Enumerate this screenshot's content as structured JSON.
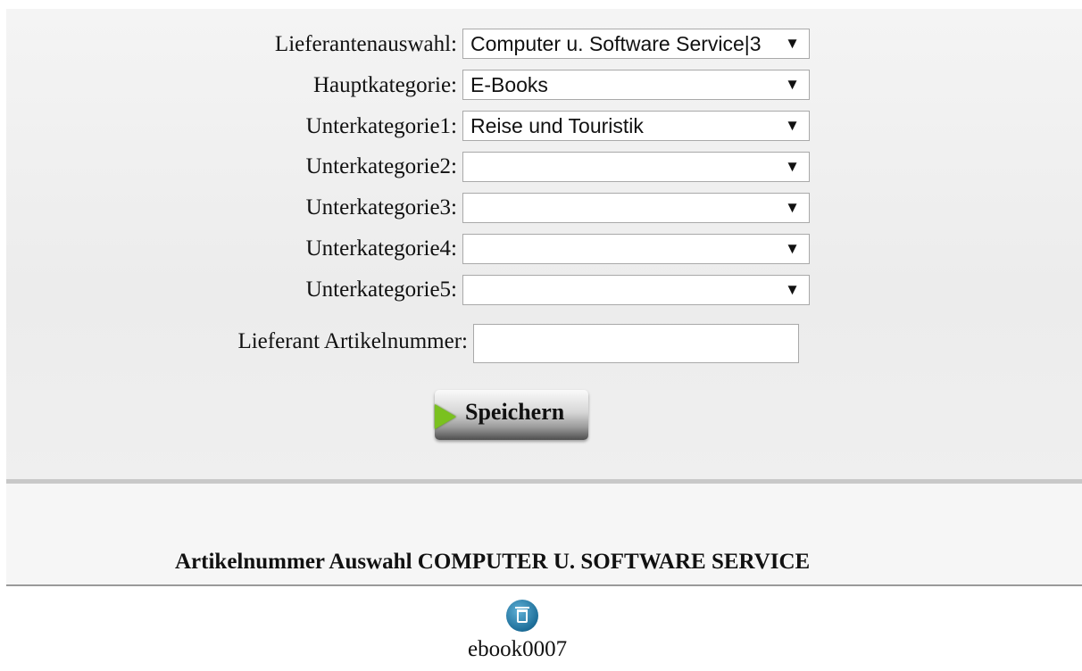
{
  "form": {
    "supplier_label": "Lieferantenauswahl:",
    "supplier_value": "Computer u. Software Service|3",
    "main_category_label": "Hauptkategorie:",
    "main_category_value": "E-Books",
    "sub1_label": "Unterkategorie1:",
    "sub1_value": "Reise und Touristik",
    "sub2_label": "Unterkategorie2:",
    "sub2_value": "",
    "sub3_label": "Unterkategorie3:",
    "sub3_value": "",
    "sub4_label": "Unterkategorie4:",
    "sub4_value": "",
    "sub5_label": "Unterkategorie5:",
    "sub5_value": "",
    "article_number_label": "Lieferant Artikelnummer:",
    "article_number_value": "",
    "save_label": "Speichern",
    "dropdown_arrow": "▼"
  },
  "selection": {
    "heading": "Artikelnummer Auswahl COMPUTER U. SOFTWARE SERVICE",
    "items": [
      {
        "label": "ebook0007",
        "icon": "trash-icon"
      }
    ]
  },
  "colors": {
    "button_play": "#7ac11f",
    "delete_icon": "#1d6e99"
  }
}
